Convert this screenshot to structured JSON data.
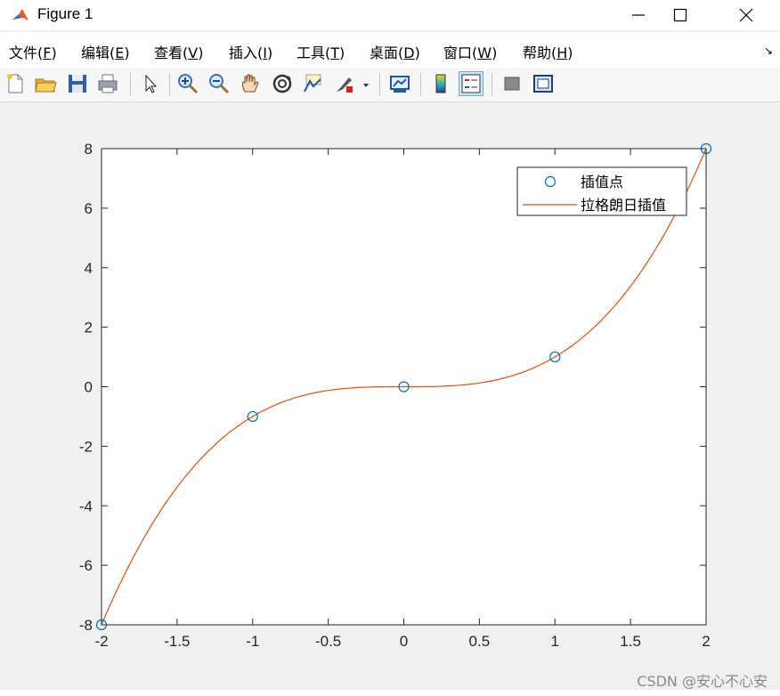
{
  "window": {
    "title": "Figure 1",
    "controls": [
      "minimize",
      "maximize",
      "close"
    ]
  },
  "menubar": {
    "items": [
      {
        "label": "文件(",
        "key": "F",
        "end": ")"
      },
      {
        "label": "编辑(",
        "key": "E",
        "end": ")"
      },
      {
        "label": "查看(",
        "key": "V",
        "end": ")"
      },
      {
        "label": "插入(",
        "key": "I",
        "end": ")"
      },
      {
        "label": "工具(",
        "key": "T",
        "end": ")"
      },
      {
        "label": "桌面(",
        "key": "D",
        "end": ")"
      },
      {
        "label": "窗口(",
        "key": "W",
        "end": ")"
      },
      {
        "label": "帮助(",
        "key": "H",
        "end": ")"
      }
    ],
    "dock_glyph": "↘"
  },
  "toolbar": {
    "icons": [
      "new-figure-icon",
      "open-file-icon",
      "save-icon",
      "print-icon",
      "select-pointer-icon",
      "zoom-in-icon",
      "zoom-out-icon",
      "pan-hand-icon",
      "rotate-3d-icon",
      "data-cursor-icon",
      "brush-icon",
      "link-plot-icon",
      "colorbar-icon",
      "legend-icon",
      "hide-plot-tools-icon",
      "show-plot-tools-icon"
    ],
    "pressed": "legend-icon"
  },
  "colors": {
    "points": "#0072BD",
    "curve": "#D95319",
    "axes": "#262626",
    "background": "#f0f0f0"
  },
  "chart_data": {
    "type": "line",
    "title": "",
    "xlabel": "",
    "ylabel": "",
    "xlim": [
      -2,
      2
    ],
    "ylim": [
      -8,
      8
    ],
    "xticks": [
      "-2",
      "-1.5",
      "-1",
      "-0.5",
      "0",
      "0.5",
      "1",
      "1.5",
      "2"
    ],
    "xtick_values": [
      -2,
      -1.5,
      -1,
      -0.5,
      0,
      0.5,
      1,
      1.5,
      2
    ],
    "yticks": [
      "-8",
      "-6",
      "-4",
      "-2",
      "0",
      "2",
      "4",
      "6",
      "8"
    ],
    "ytick_values": [
      -8,
      -6,
      -4,
      -2,
      0,
      2,
      4,
      6,
      8
    ],
    "grid": false,
    "legend_position": "top-right",
    "series": [
      {
        "name": "插值点",
        "style": "markers",
        "marker": "circle",
        "x": [
          -2,
          -1,
          0,
          1,
          2
        ],
        "y": [
          -8,
          -1,
          0,
          1,
          8
        ]
      },
      {
        "name": "拉格朗日插值",
        "style": "line",
        "function": "y = x^3",
        "x": [
          -2,
          -1.5,
          -1,
          -0.5,
          0,
          0.5,
          1,
          1.5,
          2
        ],
        "y": [
          -8,
          -3.375,
          -1,
          -0.125,
          0,
          0.125,
          1,
          3.375,
          8
        ]
      }
    ]
  },
  "watermark": "CSDN @安心不心安"
}
